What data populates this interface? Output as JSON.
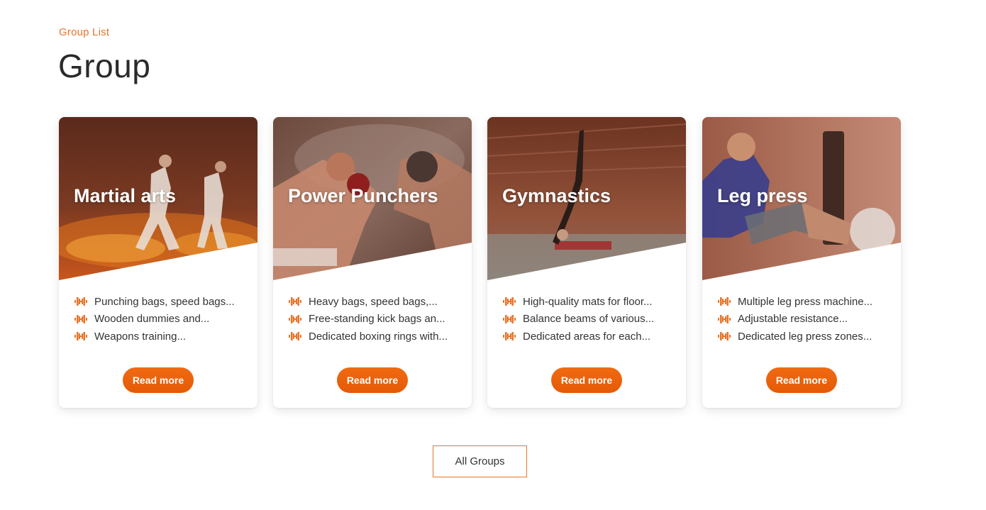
{
  "section": {
    "eyebrow": "Group List",
    "title": "Group"
  },
  "colors": {
    "accent": "#e8742a",
    "button": "#ee6510",
    "overlay": "#b5532a"
  },
  "cards": [
    {
      "title": "Martial arts",
      "image_icon": "martial-arts-photo",
      "features": [
        "Punching bags, speed bags...",
        "Wooden dummies and...",
        "Weapons training..."
      ],
      "button_label": "Read more"
    },
    {
      "title": "Power Punchers",
      "image_icon": "boxing-photo",
      "features": [
        "Heavy bags, speed bags,...",
        "Free-standing kick bags an...",
        "Dedicated boxing rings with..."
      ],
      "button_label": "Read more"
    },
    {
      "title": "Gymnastics",
      "image_icon": "gymnastics-photo",
      "features": [
        "High-quality mats for floor...",
        "Balance beams of various...",
        "Dedicated areas for each..."
      ],
      "button_label": "Read more"
    },
    {
      "title": "Leg press",
      "image_icon": "leg-press-photo",
      "features": [
        "Multiple leg press machine...",
        "Adjustable resistance...",
        "Dedicated leg press zones..."
      ],
      "button_label": "Read more"
    }
  ],
  "all_groups_label": "All Groups"
}
